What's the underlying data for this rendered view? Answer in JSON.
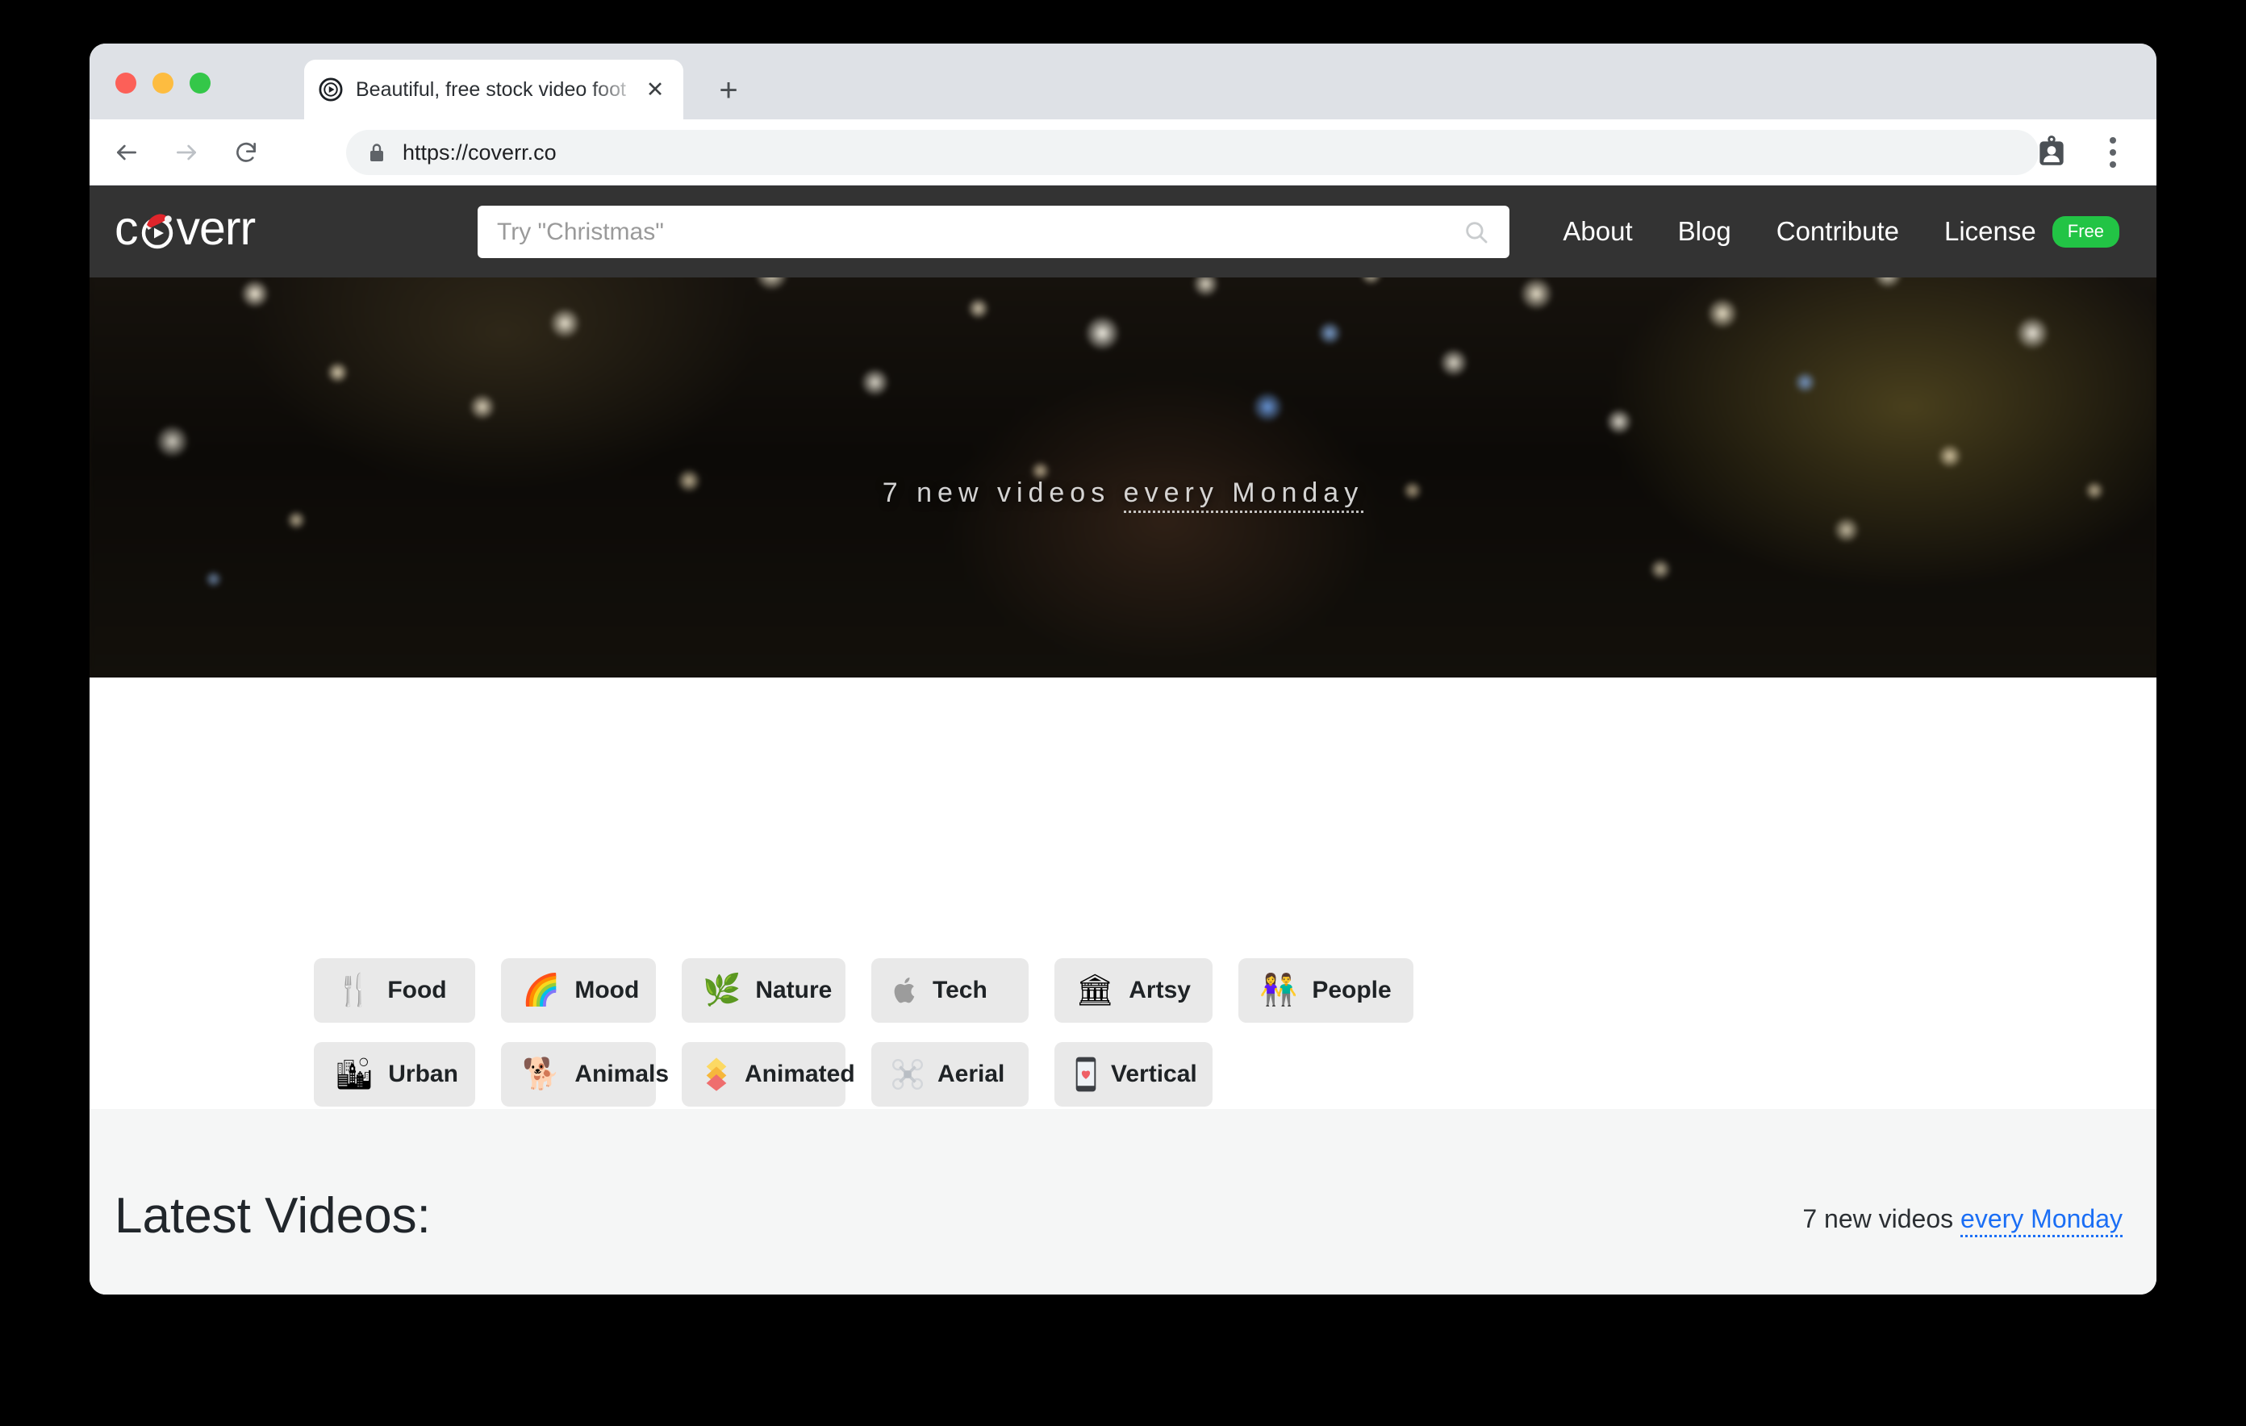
{
  "browser": {
    "tab": {
      "title": "Beautiful, free stock video foot",
      "favicon_icon": "play-circle-icon",
      "close_icon": "close-icon"
    },
    "new_tab_label": "+",
    "toolbar": {
      "back_icon": "back-arrow-icon",
      "forward_icon": "forward-arrow-icon",
      "reload_icon": "reload-icon",
      "lock_icon": "lock-icon",
      "url": "https://coverr.co",
      "profile_icon": "profile-card-icon",
      "menu_icon": "three-dot-menu-icon"
    },
    "traffic_lights": [
      "close",
      "minimize",
      "zoom"
    ]
  },
  "site": {
    "header": {
      "logo_text_before": "c",
      "logo_o_icon": "play-button-with-santa-hat-icon",
      "logo_text_after": "verr",
      "logo_full": "coverr",
      "search": {
        "placeholder": "Try \"Christmas\"",
        "value": "",
        "icon": "search-icon"
      },
      "nav": [
        {
          "label": "About"
        },
        {
          "label": "Blog"
        },
        {
          "label": "Contribute"
        },
        {
          "label": "License"
        }
      ],
      "badge": "Free",
      "badge_color": "#22c445",
      "background_color": "#333333"
    },
    "hero": {
      "caption_prefix": "7 new videos ",
      "caption_link": "every Monday",
      "image_description": "blurred bokeh christmas lights"
    },
    "categories": {
      "row1": [
        {
          "label": "Food",
          "icon": "fork-and-knife-icon",
          "emoji": "🍴"
        },
        {
          "label": "Mood",
          "icon": "rainbow-icon",
          "emoji": "🌈"
        },
        {
          "label": "Nature",
          "icon": "herb-icon",
          "emoji": "🌿"
        },
        {
          "label": "Tech",
          "icon": "apple-logo-icon",
          "emoji": ""
        },
        {
          "label": "Artsy",
          "icon": "classical-building-icon",
          "emoji": "🏛"
        },
        {
          "label": "People",
          "icon": "couple-icon",
          "emoji": "👫"
        }
      ],
      "row2": [
        {
          "label": "Urban",
          "icon": "cityscape-icon",
          "emoji": "🏙"
        },
        {
          "label": "Animals",
          "icon": "dog-icon",
          "emoji": "🐕"
        },
        {
          "label": "Animated",
          "icon": "stacked-diamonds-icon",
          "emoji": "🔶"
        },
        {
          "label": "Aerial",
          "icon": "drone-icon",
          "emoji": "✕"
        },
        {
          "label": "Vertical",
          "icon": "phone-with-heart-icon",
          "emoji": "📱"
        }
      ]
    },
    "latest": {
      "title": "Latest Videos:",
      "note_prefix": "7 new videos ",
      "note_link": "every Monday",
      "link_color": "#1a6ef5"
    }
  }
}
